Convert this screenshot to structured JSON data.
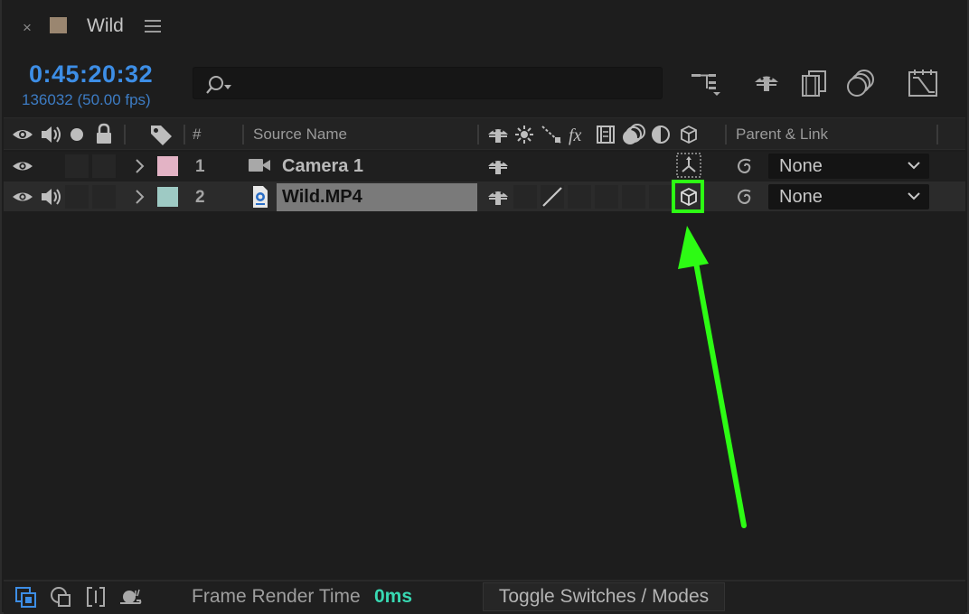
{
  "panel": {
    "close_glyph": "×",
    "title": "Wild",
    "swatch_color": "#9a8670"
  },
  "timecode": {
    "value": "0:45:20:32",
    "frames": "136032 (50.00 fps)"
  },
  "search": {
    "placeholder": ""
  },
  "toolbar": {
    "icons": [
      "comp-flowchart-icon",
      "shy-layers-icon",
      "frame-blending-icon",
      "motion-blur-icon",
      "graph-editor-icon"
    ]
  },
  "columns": {
    "hash": "#",
    "source_name": "Source Name",
    "parent_link": "Parent & Link"
  },
  "layers": [
    {
      "index": "1",
      "name": "Camera 1",
      "label_color": "#e3b3c5",
      "type": "camera",
      "parent": "None"
    },
    {
      "index": "2",
      "name": "Wild.MP4",
      "label_color": "#9ecac4",
      "type": "footage",
      "parent": "None",
      "selected": true,
      "three_d_layer": true
    }
  ],
  "annotation": {
    "highlight_color": "#2dfb14",
    "target": "3d-layer-switch"
  },
  "footer": {
    "frame_render_label": "Frame Render Time",
    "frame_render_value": "0ms",
    "toggle_label": "Toggle Switches / Modes"
  }
}
